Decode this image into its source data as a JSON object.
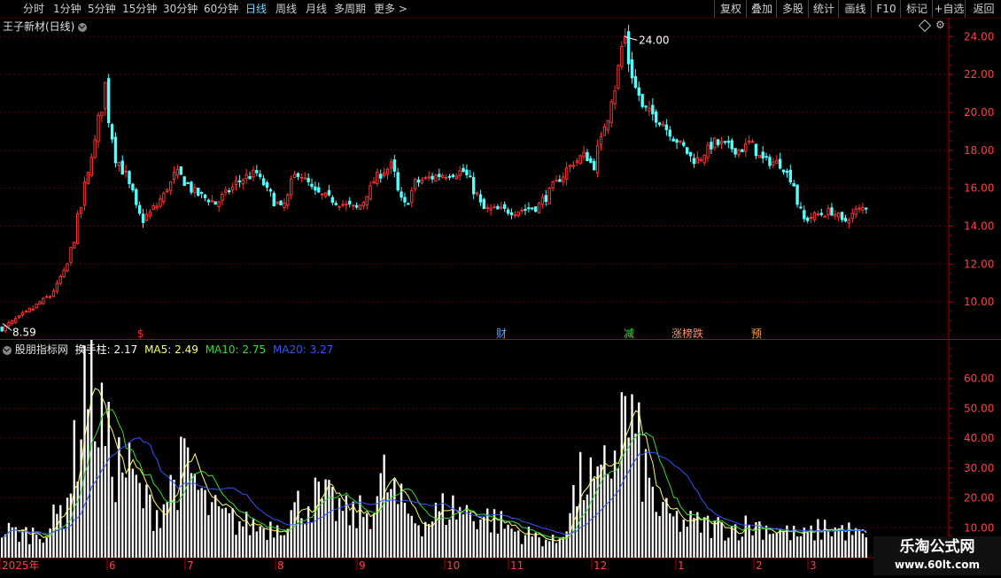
{
  "toolbar": {
    "periods": [
      "分时",
      "1分钟",
      "5分钟",
      "15分钟",
      "30分钟",
      "60分钟",
      "日线",
      "周线",
      "月线",
      "多周期",
      "更多 >"
    ],
    "active_period": "日线",
    "actions": [
      "复权",
      "叠加",
      "多股",
      "统计",
      "画线",
      "F10",
      "标记",
      "+自选",
      "返回"
    ]
  },
  "main_panel": {
    "title": "王子新材(日线)",
    "high_label": "24.00",
    "low_label": "8.59",
    "events": [
      {
        "label": "$",
        "color": "#ff3030"
      },
      {
        "label": "财",
        "color": "#4aa8ff"
      },
      {
        "label": "减",
        "color": "#30e030"
      },
      {
        "label": "涨榜跌",
        "color": "#ff9060"
      },
      {
        "label": "预",
        "color": "#ffa030"
      }
    ],
    "y_ticks": [
      "24.00",
      "22.00",
      "20.00",
      "18.00",
      "16.00",
      "14.00",
      "12.00",
      "10.00"
    ]
  },
  "sub_panel": {
    "indicator_name": "股朋指标网",
    "label_main": "换手柱: 2.17",
    "label_ma5": "MA5: 2.49",
    "label_ma10": "MA10: 2.75",
    "label_ma20": "MA20: 3.27",
    "y_ticks": [
      "60.00",
      "50.00",
      "40.00",
      "30.00",
      "20.00",
      "10.00"
    ]
  },
  "x_axis": {
    "labels": [
      "2025年",
      "6",
      "7",
      "8",
      "9",
      "10",
      "11",
      "12",
      "1",
      "2",
      "3"
    ]
  },
  "watermark": {
    "line1": "乐淘公式网",
    "line2": "www.60lt.com"
  },
  "colors": {
    "up": "#ff3232",
    "down": "#54ffff",
    "axis": "#b00000",
    "ma5": "#ffff66",
    "ma10": "#33dd33",
    "ma20": "#3355ff"
  },
  "chart_data": {
    "type": "candlestick",
    "price_ylim": [
      8,
      25
    ],
    "turnover_ylim": [
      0,
      70
    ],
    "price_anchors": [
      [
        0,
        8.6
      ],
      [
        10,
        9.4
      ],
      [
        22,
        10.4
      ],
      [
        30,
        12.2
      ],
      [
        35,
        15.0
      ],
      [
        42,
        19.0
      ],
      [
        46,
        21.5
      ],
      [
        50,
        17.8
      ],
      [
        56,
        16.5
      ],
      [
        62,
        14.2
      ],
      [
        70,
        15.2
      ],
      [
        78,
        16.9
      ],
      [
        86,
        15.8
      ],
      [
        96,
        15.2
      ],
      [
        106,
        16.4
      ],
      [
        114,
        16.8
      ],
      [
        122,
        15.3
      ],
      [
        126,
        14.8
      ],
      [
        132,
        17.0
      ],
      [
        140,
        15.8
      ],
      [
        152,
        15.2
      ],
      [
        160,
        14.9
      ],
      [
        168,
        16.6
      ],
      [
        175,
        17.2
      ],
      [
        180,
        14.9
      ],
      [
        186,
        16.3
      ],
      [
        196,
        16.7
      ],
      [
        208,
        16.9
      ],
      [
        216,
        14.9
      ],
      [
        230,
        14.8
      ],
      [
        240,
        15.0
      ],
      [
        246,
        15.8
      ],
      [
        252,
        16.7
      ],
      [
        256,
        17.3
      ],
      [
        262,
        17.8
      ],
      [
        266,
        17.2
      ],
      [
        272,
        19.8
      ],
      [
        276,
        21.8
      ],
      [
        280,
        24.0
      ],
      [
        283,
        22.0
      ],
      [
        288,
        20.2
      ],
      [
        296,
        19.6
      ],
      [
        304,
        18.4
      ],
      [
        312,
        17.4
      ],
      [
        320,
        18.4
      ],
      [
        332,
        18.0
      ],
      [
        336,
        18.4
      ],
      [
        342,
        17.5
      ],
      [
        350,
        17.3
      ],
      [
        356,
        16.2
      ],
      [
        360,
        14.3
      ],
      [
        366,
        14.6
      ],
      [
        374,
        14.8
      ],
      [
        378,
        14.2
      ],
      [
        384,
        14.8
      ],
      [
        390,
        15.1
      ]
    ],
    "turnover_anchors": [
      [
        0,
        9
      ],
      [
        10,
        8
      ],
      [
        20,
        9
      ],
      [
        28,
        18
      ],
      [
        34,
        40
      ],
      [
        36,
        64
      ],
      [
        40,
        60
      ],
      [
        44,
        45
      ],
      [
        50,
        32
      ],
      [
        56,
        30
      ],
      [
        62,
        20
      ],
      [
        70,
        15
      ],
      [
        78,
        28
      ],
      [
        84,
        30
      ],
      [
        90,
        18
      ],
      [
        100,
        13
      ],
      [
        110,
        11
      ],
      [
        118,
        10
      ],
      [
        126,
        12
      ],
      [
        134,
        18
      ],
      [
        140,
        20
      ],
      [
        148,
        18
      ],
      [
        156,
        14
      ],
      [
        164,
        15
      ],
      [
        172,
        26
      ],
      [
        178,
        18
      ],
      [
        184,
        14
      ],
      [
        190,
        12
      ],
      [
        200,
        17
      ],
      [
        210,
        15
      ],
      [
        220,
        13
      ],
      [
        230,
        9
      ],
      [
        240,
        7
      ],
      [
        250,
        5
      ],
      [
        256,
        18
      ],
      [
        262,
        28
      ],
      [
        268,
        22
      ],
      [
        272,
        30
      ],
      [
        276,
        38
      ],
      [
        280,
        48
      ],
      [
        284,
        42
      ],
      [
        290,
        25
      ],
      [
        296,
        15
      ],
      [
        304,
        12
      ],
      [
        316,
        11
      ],
      [
        326,
        10
      ],
      [
        340,
        11
      ],
      [
        350,
        9
      ],
      [
        360,
        7
      ],
      [
        370,
        10
      ],
      [
        380,
        9
      ],
      [
        390,
        6
      ]
    ],
    "n_candles": 390,
    "series": [
      {
        "name": "换手柱"
      },
      {
        "name": "MA5"
      },
      {
        "name": "MA10"
      },
      {
        "name": "MA20"
      }
    ]
  }
}
